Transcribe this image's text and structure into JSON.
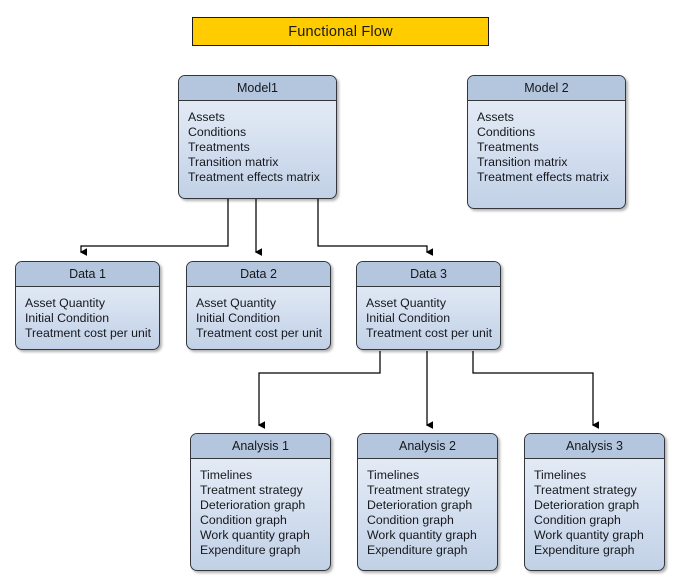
{
  "diagram": {
    "title": "Functional Flow",
    "background_color": "#ffffff",
    "title_color": "#FFCC00",
    "node_header_color": "#b4c6de",
    "node_border_color": "#33373b",
    "connector_color": "#000000",
    "nodes": [
      {
        "id": "model1",
        "title": "Model1",
        "rows": [
          "Assets",
          "Conditions",
          "Treatments",
          "Transition matrix",
          "Treatment effects matrix"
        ]
      },
      {
        "id": "model2",
        "title": "Model 2",
        "rows": [
          "Assets",
          "Conditions",
          "Treatments",
          "Transition matrix",
          "Treatment effects matrix"
        ]
      },
      {
        "id": "data1",
        "title": "Data  1",
        "rows": [
          "Asset Quantity",
          "Initial Condition",
          "Treatment cost per unit"
        ]
      },
      {
        "id": "data2",
        "title": "Data 2",
        "rows": [
          "Asset Quantity",
          "Initial Condition",
          "Treatment cost per unit"
        ]
      },
      {
        "id": "data3",
        "title": "Data 3",
        "rows": [
          "Asset Quantity",
          "Initial Condition",
          "Treatment cost per unit"
        ]
      },
      {
        "id": "analysis1",
        "title": "Analysis 1",
        "rows": [
          "Timelines",
          "Treatment strategy",
          "Deterioration graph",
          "Condition graph",
          "Work quantity graph",
          "Expenditure graph"
        ]
      },
      {
        "id": "analysis2",
        "title": "Analysis 2",
        "rows": [
          "Timelines",
          "Treatment strategy",
          "Deterioration graph",
          "Condition graph",
          "Work quantity graph",
          "Expenditure graph"
        ]
      },
      {
        "id": "analysis3",
        "title": "Analysis 3",
        "rows": [
          "Timelines",
          "Treatment strategy",
          "Deterioration graph",
          "Condition graph",
          "Work quantity graph",
          "Expenditure graph"
        ]
      }
    ],
    "edges": [
      {
        "from": "model1",
        "to": "data1"
      },
      {
        "from": "model1",
        "to": "data2"
      },
      {
        "from": "model1",
        "to": "data3"
      },
      {
        "from": "data3",
        "to": "analysis1"
      },
      {
        "from": "data3",
        "to": "analysis2"
      },
      {
        "from": "data3",
        "to": "analysis3"
      }
    ]
  }
}
